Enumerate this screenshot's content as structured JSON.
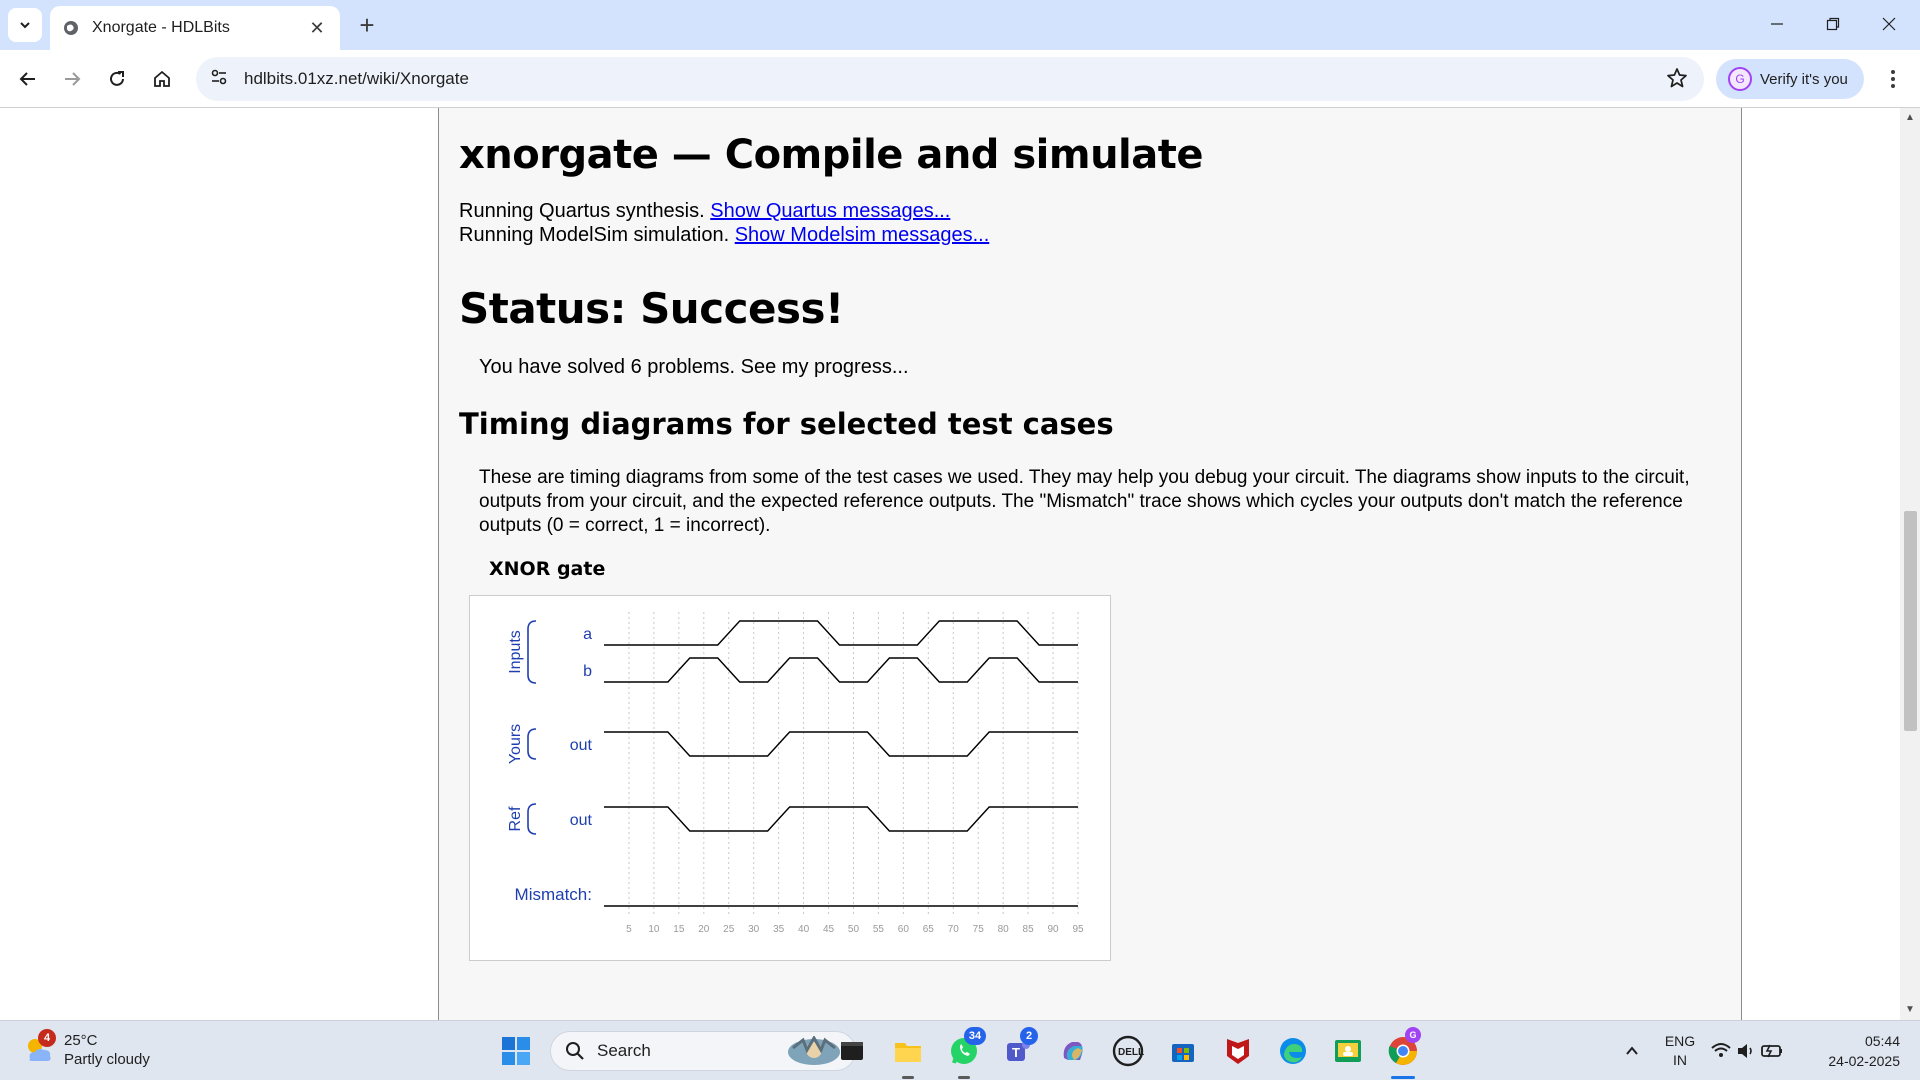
{
  "browser": {
    "tab_title": "Xnorgate - HDLBits",
    "url": "hdlbits.01xz.net/wiki/Xnorgate",
    "verify_label": "Verify it's you",
    "avatar_letter": "G"
  },
  "page": {
    "heading": "xnorgate — Compile and simulate",
    "quartus_text": "Running Quartus synthesis.",
    "quartus_link": "Show Quartus messages...",
    "modelsim_text": "Running ModelSim simulation.",
    "modelsim_link": "Show Modelsim messages...",
    "status": "Status: Success!",
    "solved_text": "You have solved 6 problems.",
    "progress_link": "See my progress...",
    "timing_heading": "Timing diagrams for selected test cases",
    "timing_paragraph": "These are timing diagrams from some of the test cases we used. They may help you debug your circuit. The diagrams show inputs to the circuit, outputs from your circuit, and the expected reference outputs. The \"Mismatch\" trace shows which cycles your outputs don't match the reference outputs (0 = correct, 1 = incorrect).",
    "diagram_title": "XNOR gate"
  },
  "chart_data": {
    "type": "timing",
    "group_labels": [
      "Inputs",
      "Yours",
      "Ref"
    ],
    "mismatch_label": "Mismatch:",
    "x_ticks": [
      5,
      10,
      15,
      20,
      25,
      30,
      35,
      40,
      45,
      50,
      55,
      60,
      65,
      70,
      75,
      80,
      85,
      90,
      95
    ],
    "signals": [
      {
        "group": "Inputs",
        "name": "a",
        "times": [
          0,
          25,
          45,
          65,
          85
        ],
        "values": [
          0,
          1,
          0,
          1,
          0
        ]
      },
      {
        "group": "Inputs",
        "name": "b",
        "times": [
          0,
          15,
          25,
          35,
          45,
          55,
          65,
          75,
          85
        ],
        "values": [
          0,
          1,
          0,
          1,
          0,
          1,
          0,
          1,
          0
        ]
      },
      {
        "group": "Yours",
        "name": "out",
        "times": [
          0,
          15,
          35,
          55,
          75
        ],
        "values": [
          1,
          0,
          1,
          0,
          1
        ]
      },
      {
        "group": "Ref",
        "name": "out",
        "times": [
          0,
          15,
          35,
          55,
          75
        ],
        "values": [
          1,
          0,
          1,
          0,
          1
        ]
      },
      {
        "group": "Mismatch",
        "name": "mismatch",
        "times": [
          0
        ],
        "values": [
          0
        ]
      }
    ],
    "t_end": 95,
    "colors": {
      "label": "#1f3fb0",
      "trace": "#000000",
      "grid": "#c8c8c8",
      "tick": "#9a9a9a"
    }
  },
  "taskbar": {
    "weather_temp": "25°C",
    "weather_desc": "Partly cloudy",
    "weather_badge": "4",
    "search_label": "Search",
    "whatsapp_badge": "34",
    "teams_badge": "2",
    "lang_top": "ENG",
    "lang_bottom": "IN",
    "time": "05:44",
    "date": "24-02-2025"
  }
}
